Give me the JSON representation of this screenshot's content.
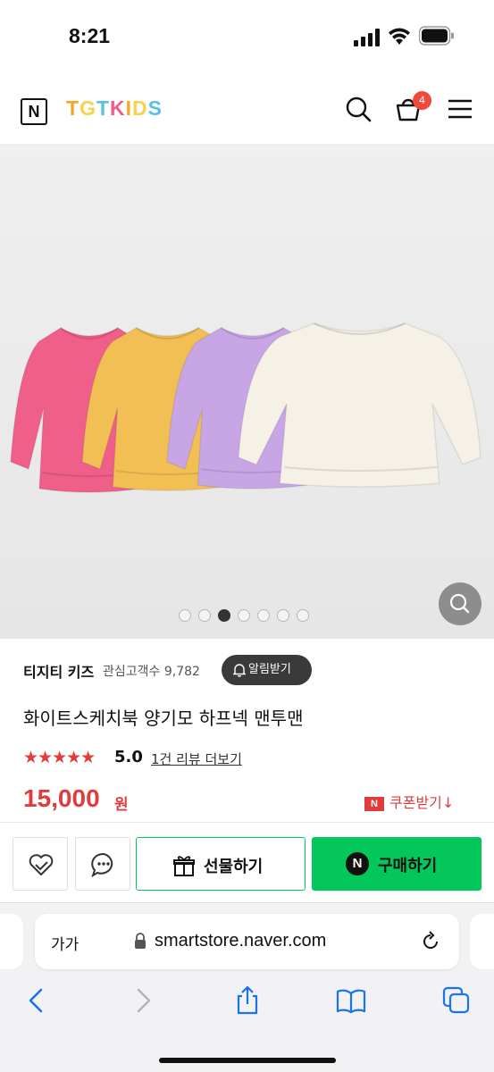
{
  "status_bar": {
    "time": "8:21"
  },
  "header": {
    "naver_logo": "N",
    "brand_letters": [
      {
        "ch": "T",
        "color": "#f5a623"
      },
      {
        "ch": "G",
        "color": "#f7d24a"
      },
      {
        "ch": "T",
        "color": "#5bbfe8"
      },
      {
        "ch": "K",
        "color": "#ef5b8a"
      },
      {
        "ch": "I",
        "color": "#f5a623"
      },
      {
        "ch": "D",
        "color": "#f7d24a"
      },
      {
        "ch": "S",
        "color": "#5bbfe8"
      }
    ],
    "cart_count": "4"
  },
  "gallery": {
    "sweatshirt_colors": [
      "#ef5f8a",
      "#f2bf55",
      "#c8a6e6",
      "#f5f1e6"
    ],
    "dot_count": 7,
    "active_index": 2
  },
  "product": {
    "store_name": "티지티 키즈",
    "interest": "관심고객수 9,782",
    "alarm_label": "알림받기",
    "title": "화이트스케치북 양기모 하프넥 맨투맨",
    "stars": "★★★★★",
    "rating": "5.0",
    "review_link": "1건 리뷰 더보기",
    "price": "15,000",
    "currency": "원",
    "coupon_badge": "N",
    "coupon_label": "쿠폰받기↓"
  },
  "actions": {
    "gift_label": "선물하기",
    "buy_badge": "N",
    "buy_label": "구매하기"
  },
  "safari": {
    "text_size": "가가",
    "url": "smartstore.naver.com"
  },
  "colors": {
    "accent_red": "#e03c3c",
    "naver_green": "#03c75a"
  }
}
